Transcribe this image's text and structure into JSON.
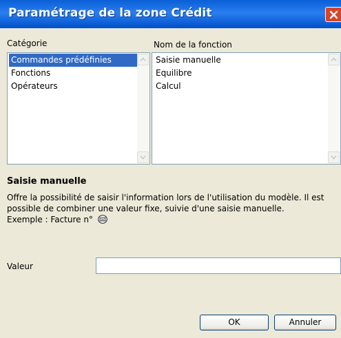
{
  "window": {
    "title": "Paramétrage de la zone Crédit"
  },
  "category": {
    "label": "Catégorie",
    "items": [
      "Commandes prédéfinies",
      "Fonctions",
      "Opérateurs"
    ],
    "selected_index": 0
  },
  "function": {
    "label": "Nom de la fonction",
    "items": [
      "Saisie manuelle",
      "Equilibre",
      "Calcul"
    ]
  },
  "description": {
    "title": "Saisie manuelle",
    "line1": "Offre la possibilité de saisir l'information lors de l'utilisation du modèle. Il est",
    "line2": "possible de combiner une valeur fixe, suivie d'une saisie manuelle.",
    "line3": "Exemple : Facture n°"
  },
  "valeur": {
    "label": "Valeur",
    "value": ""
  },
  "buttons": {
    "ok": "OK",
    "cancel": "Annuler"
  },
  "icons": {
    "close": "close-icon",
    "keyboard": "keyboard-icon",
    "scroll_up": "scroll-up-icon",
    "scroll_down": "scroll-down-icon"
  },
  "colors": {
    "titlebar": "#0a5fd6",
    "selection": "#316ac5",
    "close": "#d8442a",
    "dialog_bg": "#ece9d8"
  }
}
